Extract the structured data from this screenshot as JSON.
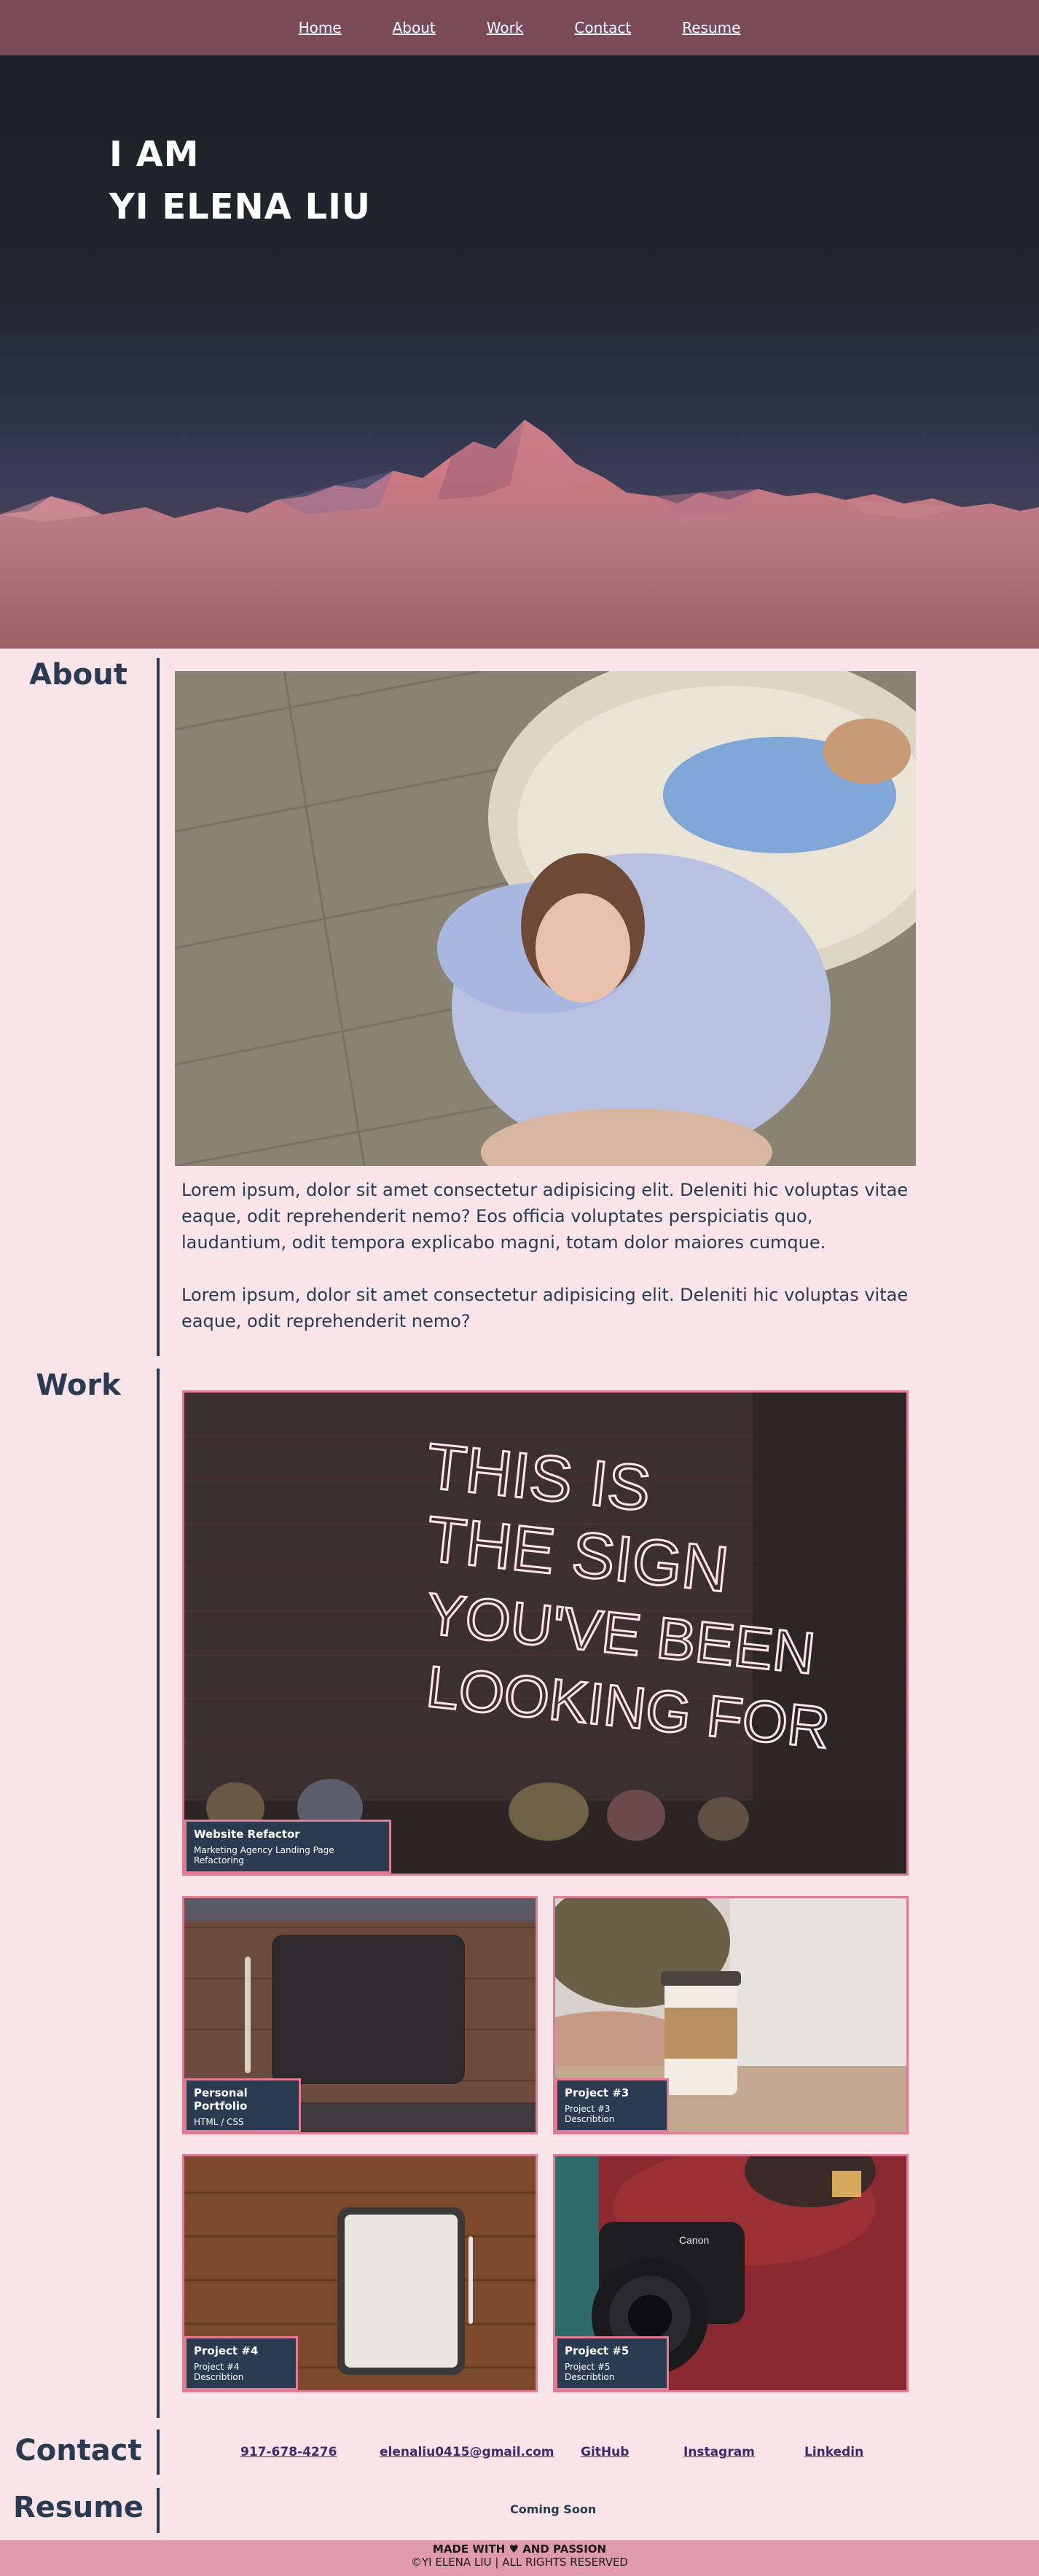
{
  "nav": {
    "items": [
      {
        "label": "Home"
      },
      {
        "label": "About"
      },
      {
        "label": "Work"
      },
      {
        "label": "Contact"
      },
      {
        "label": "Resume"
      }
    ]
  },
  "hero": {
    "line1": "I AM",
    "line2": "YI ELENA LIU"
  },
  "about": {
    "heading": "About",
    "paragraphs": [
      "Lorem ipsum, dolor sit amet consectetur adipisicing elit. Deleniti hic voluptas vitae eaque, odit reprehenderit nemo? Eos officia voluptates perspiciatis quo, laudantium, odit tempora explicabo magni, totam dolor maiores cumque.",
      "Lorem ipsum, dolor sit amet consectetur adipisicing elit. Deleniti hic voluptas vitae eaque, odit reprehenderit nemo?"
    ]
  },
  "work": {
    "heading": "Work",
    "neon_text": [
      "THIS IS",
      "THE SIGN",
      "YOU'VE BEEN",
      "LOOKING FOR"
    ],
    "projects": [
      {
        "title": "Website Refactor",
        "desc": "Marketing Agency Landing Page Refactoring"
      },
      {
        "title": "Personal Portfolio",
        "desc": "HTML / CSS"
      },
      {
        "title": "Project #3",
        "desc": "Project #3 Describtion"
      },
      {
        "title": "Project #4",
        "desc": "Project #4 Describtion"
      },
      {
        "title": "Project #5",
        "desc": "Project #5 Describtion"
      }
    ],
    "camera_brand": "Canon"
  },
  "contact": {
    "heading": "Contact",
    "links": [
      {
        "label": "917-678-4276"
      },
      {
        "label": "elenaliu0415@gmail.com"
      },
      {
        "label": "GitHub"
      },
      {
        "label": "Instagram"
      },
      {
        "label": "Linkedin"
      }
    ]
  },
  "resume": {
    "heading": "Resume",
    "status": "Coming Soon"
  },
  "footer": {
    "line1_pre": "MADE WITH",
    "line1_post": "AND PASSION",
    "heart_icon": "heart-icon",
    "line2": "©YI ELENA LIU | ALL RIGHTS RESERVED"
  },
  "colors": {
    "nav_bg": "#7b4a59",
    "page_bg": "#f9e4ea",
    "accent_pink": "#e07b94",
    "text_dark": "#2a3a50",
    "footer_bg": "#e09aaa"
  }
}
